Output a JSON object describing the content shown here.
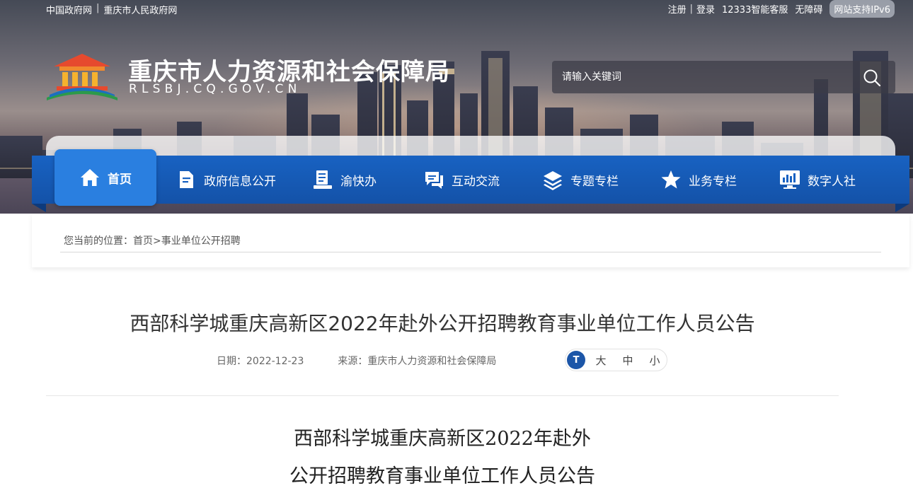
{
  "topbar": {
    "left_links": [
      "中国政府网",
      "重庆市人民政府网"
    ],
    "register": "注册",
    "login": "登录",
    "service": "12333智能客服",
    "accessibility": "无障碍",
    "ipv6": "网站支持IPv6"
  },
  "site": {
    "title": "重庆市人力资源和社会保障局",
    "domain": "RLSBJ.CQ.GOV.CN"
  },
  "search": {
    "placeholder": "请输入关键词"
  },
  "nav": {
    "items": [
      {
        "label": "首页",
        "icon": "home-icon",
        "active": true
      },
      {
        "label": "政府信息公开",
        "icon": "document-icon"
      },
      {
        "label": "渝快办",
        "icon": "service-desk-icon"
      },
      {
        "label": "互动交流",
        "icon": "chat-icon"
      },
      {
        "label": "专题专栏",
        "icon": "layers-icon"
      },
      {
        "label": "业务专栏",
        "icon": "star-icon"
      },
      {
        "label": "数字人社",
        "icon": "monitor-chart-icon"
      }
    ]
  },
  "breadcrumb": {
    "prefix": "您当前的位置：",
    "home": "首页",
    "separator": ">",
    "current": "事业单位公开招聘"
  },
  "article": {
    "title": "西部科学城重庆高新区2022年赴外公开招聘教育事业单位工作人员公告",
    "date_label": "日期：",
    "date": "2022-12-23",
    "source_label": "来源：",
    "source": "重庆市人力资源和社会保障局",
    "fontsize": {
      "badge": "T",
      "large": "大",
      "medium": "中",
      "small": "小"
    },
    "body_title_line1": "西部科学城重庆高新区2022年赴外",
    "body_title_line2": "公开招聘教育事业单位工作人员公告"
  },
  "colors": {
    "nav_blue": "#1862c2",
    "nav_active": "#2a7fe0",
    "badge_blue": "#1c56a8"
  }
}
